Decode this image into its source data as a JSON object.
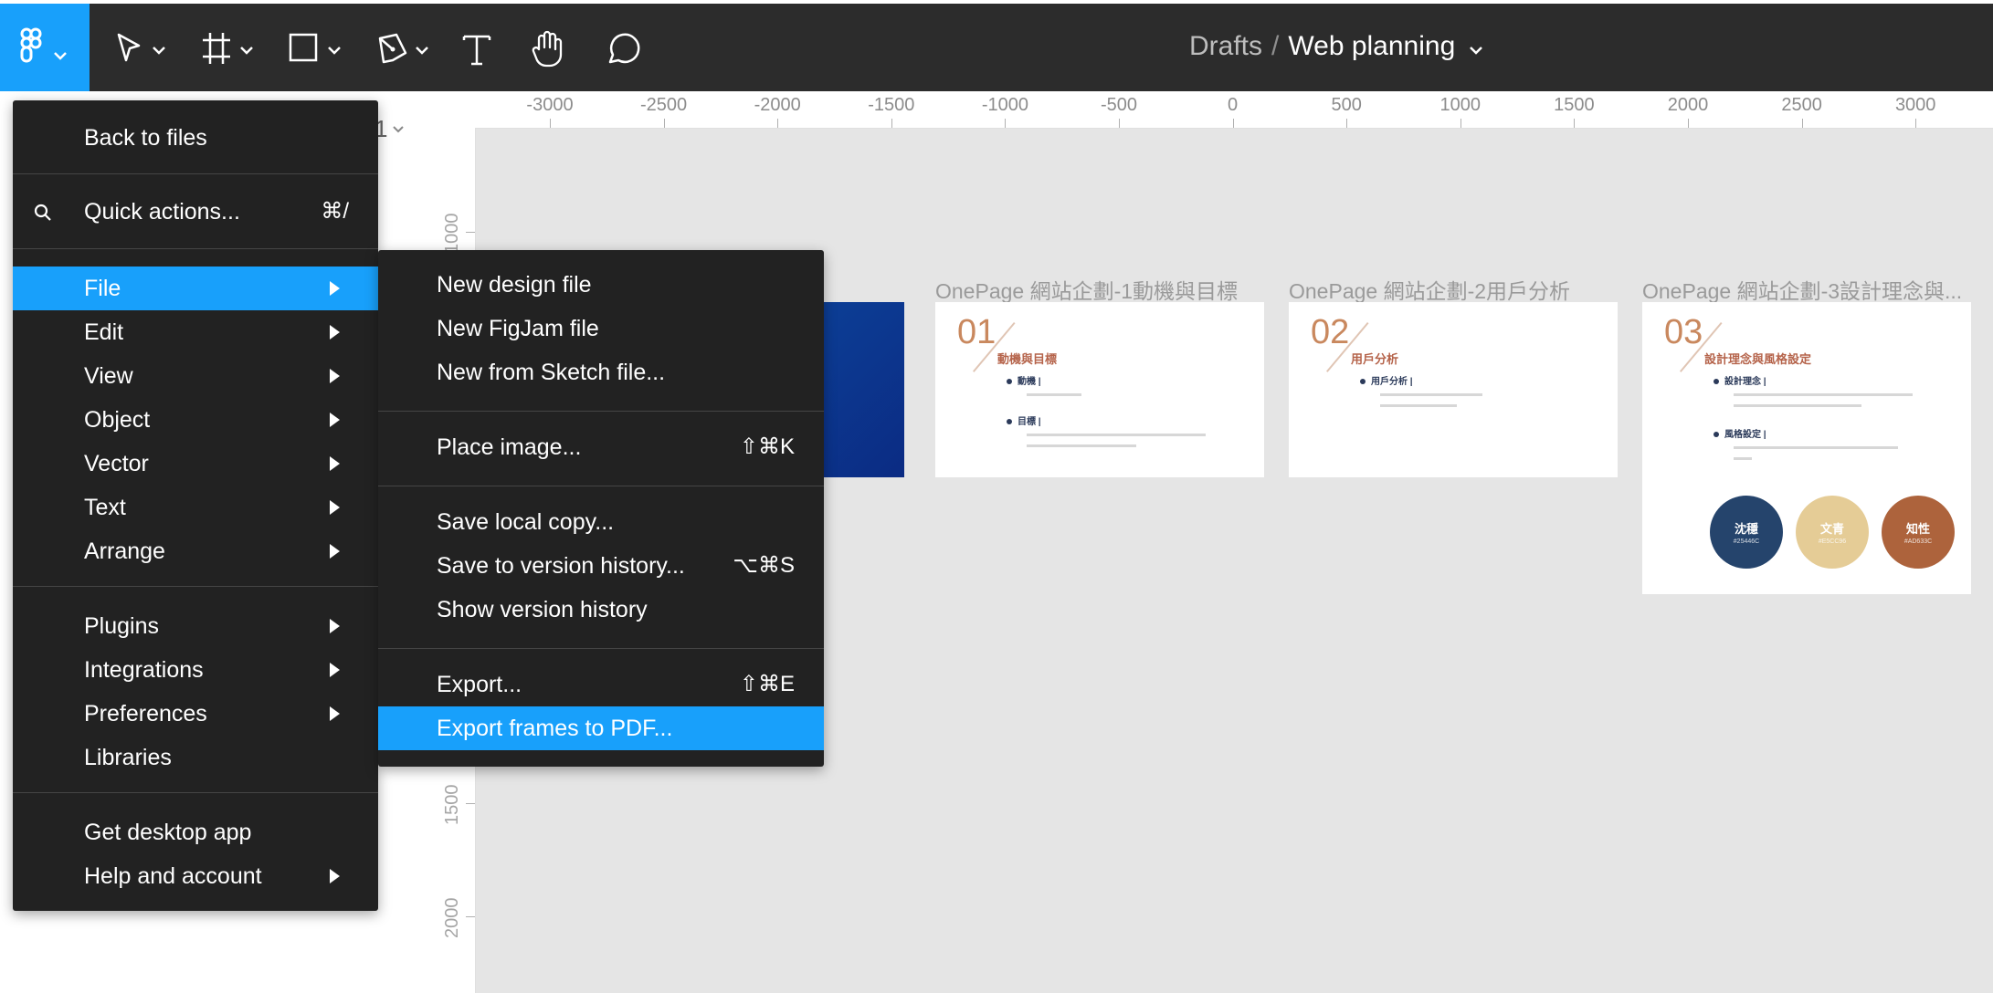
{
  "toolbar": {
    "breadcrumb_parent": "Drafts",
    "breadcrumb_sep": "/",
    "file_name": "Web planning",
    "tools": [
      "main-menu",
      "move",
      "frame",
      "shape",
      "pen",
      "text",
      "hand",
      "comment"
    ]
  },
  "left_panel": {
    "page_fragment": "1"
  },
  "ruler": {
    "top_ticks": [
      "-3000",
      "-2500",
      "-2000",
      "-1500",
      "-1000",
      "-500",
      "0",
      "500",
      "1000",
      "1500",
      "2000",
      "2500",
      "3000"
    ],
    "left_ticks": [
      "1000",
      "1500",
      "2000"
    ]
  },
  "frames": [
    {
      "title": "OnePage 網站企劃-1動機與目標",
      "number": "01",
      "heading": "動機與目標",
      "bullets": [
        "動機 |",
        "目標 |"
      ]
    },
    {
      "title": "OnePage 網站企劃-2用戶分析",
      "number": "02",
      "heading": "用戶分析",
      "bullets": [
        "用戶分析 |"
      ]
    },
    {
      "title": "OnePage 網站企劃-3設計理念與...",
      "number": "03",
      "heading": "設計理念與風格設定",
      "bullets": [
        "設計理念 |",
        "風格設定 |"
      ],
      "swatches": [
        {
          "label": "沈穩",
          "code": "#25446C",
          "color": "#25446c"
        },
        {
          "label": "文青",
          "code": "#E5CC96",
          "color": "#e5cc96"
        },
        {
          "label": "知性",
          "code": "#AD633C",
          "color": "#ad633c"
        }
      ]
    }
  ],
  "main_menu": {
    "items": [
      {
        "label": "Back to files"
      },
      {
        "label": "Quick actions...",
        "shortcut": "⌘/"
      },
      {
        "label": "File",
        "highlighted": true
      },
      {
        "label": "Edit"
      },
      {
        "label": "View"
      },
      {
        "label": "Object"
      },
      {
        "label": "Vector"
      },
      {
        "label": "Text"
      },
      {
        "label": "Arrange"
      },
      {
        "label": "Plugins"
      },
      {
        "label": "Integrations"
      },
      {
        "label": "Preferences"
      },
      {
        "label": "Libraries"
      },
      {
        "label": "Get desktop app"
      },
      {
        "label": "Help and account"
      }
    ]
  },
  "file_submenu": {
    "items": [
      {
        "label": "New design file"
      },
      {
        "label": "New FigJam file"
      },
      {
        "label": "New from Sketch file..."
      },
      {
        "label": "Place image...",
        "shortcut": "⇧⌘K"
      },
      {
        "label": "Save local copy..."
      },
      {
        "label": "Save to version history...",
        "shortcut": "⌥⌘S"
      },
      {
        "label": "Show version history"
      },
      {
        "label": "Export...",
        "shortcut": "⇧⌘E"
      },
      {
        "label": "Export frames to PDF...",
        "highlighted": true
      }
    ]
  },
  "colors": {
    "accent": "#18a0fb",
    "toolbar": "#2c2c2c",
    "menu": "#222222",
    "canvas": "#e5e5e5"
  }
}
